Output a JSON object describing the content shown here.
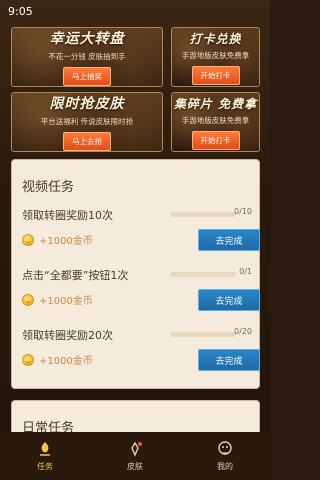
{
  "status": {
    "time": "9:05"
  },
  "banners": [
    {
      "title": "幸运大转盘",
      "subtitle": "不花一分钱 皮肤抽到手",
      "button": "马上抽奖"
    },
    {
      "title": "打卡兑换",
      "subtitle": "手游地版皮肤免费拿",
      "button": "开始打卡"
    },
    {
      "title": "限时抢皮肤",
      "subtitle": "平台送福利 传说皮肤限时抢",
      "button": "马上去抢"
    },
    {
      "title": "集碎片 免费拿",
      "subtitle": "手游地版皮肤免费拿",
      "button": "开始打卡"
    }
  ],
  "video_tasks": {
    "title": "视频任务",
    "items": [
      {
        "name": "领取转圈奖励10次",
        "count": "0/10",
        "progress": 0,
        "reward": "+1000金币",
        "button": "去完成"
      },
      {
        "name": "点击“全都要”按钮1次",
        "count": "0/1",
        "progress": 0,
        "reward": "+1000金币",
        "button": "去完成"
      },
      {
        "name": "领取转圈奖励20次",
        "count": "0/20",
        "progress": 0,
        "reward": "+1000金币",
        "button": "去完成"
      }
    ]
  },
  "daily_tasks": {
    "title": "日常任务"
  },
  "nav": {
    "items": [
      {
        "label": "任务",
        "icon": "task-icon",
        "active": true
      },
      {
        "label": "皮肤",
        "icon": "skin-icon",
        "active": false
      },
      {
        "label": "我的",
        "icon": "profile-icon",
        "active": false
      }
    ]
  },
  "colors": {
    "accent": "#f2c24a",
    "button_blue": "#1e6aa5",
    "reward": "#c9894a"
  }
}
